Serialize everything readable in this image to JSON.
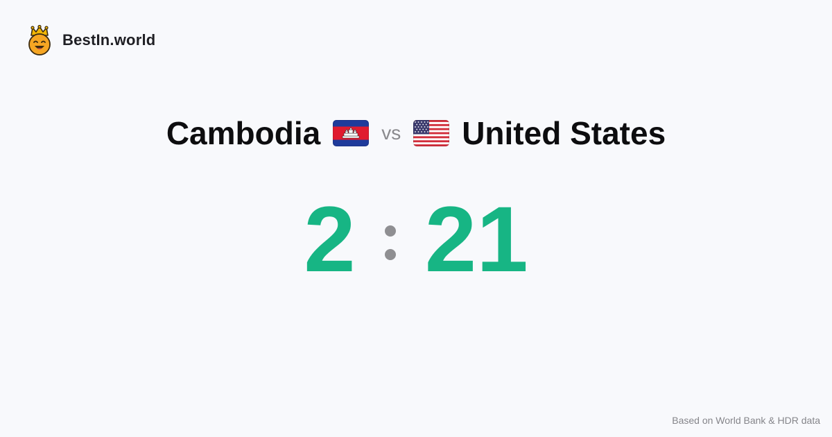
{
  "brand": {
    "name": "BestIn.world",
    "logo_icon": "crown-smiley-icon"
  },
  "matchup": {
    "left_country": "Cambodia",
    "left_flag_icon": "cambodia-flag-icon",
    "vs_label": "vs",
    "right_country": "United States",
    "right_flag_icon": "united-states-flag-icon"
  },
  "score": {
    "left": "2",
    "right": "21"
  },
  "footer": {
    "source_text": "Based on World Bank & HDR data"
  },
  "colors": {
    "background": "#f8f9fc",
    "score": "#17b584",
    "separator": "#8f8f92",
    "vs": "#8a8a8e",
    "footer": "#85858a"
  }
}
